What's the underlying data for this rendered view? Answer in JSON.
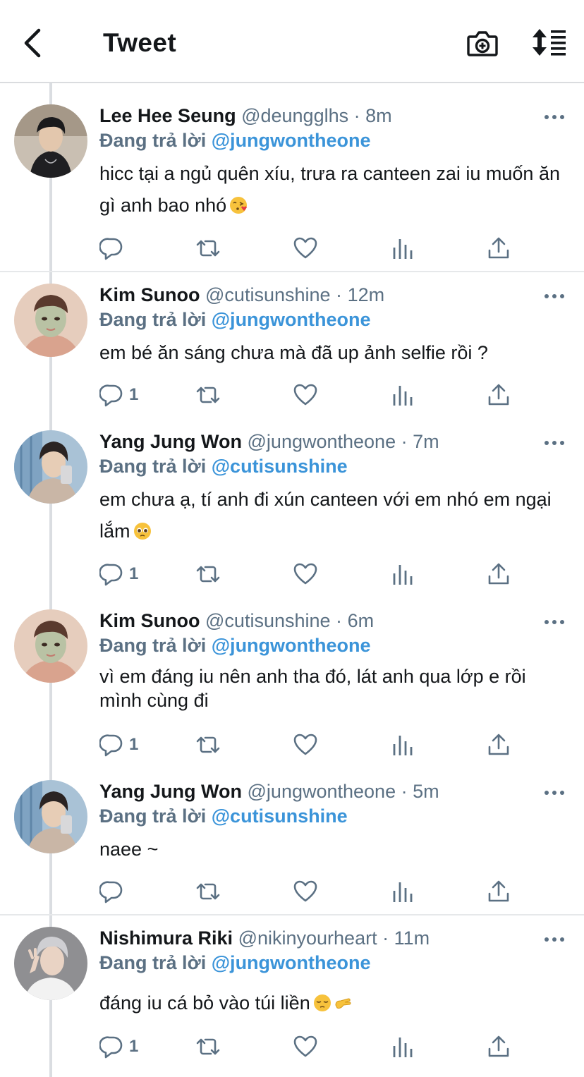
{
  "header": {
    "title": "Tweet",
    "back_icon": "chevron-left-icon",
    "camera_icon": "camera-add-icon",
    "sort_icon": "sort-icon"
  },
  "colors": {
    "mention": "#3b94d9",
    "muted": "#5b7083",
    "text": "#14171a",
    "separator": "#e6e8ea",
    "thread_line": "#dadde1"
  },
  "tweets": [
    {
      "name": "Lee Hee Seung",
      "handle": "@deungglhs",
      "dot": "·",
      "time": "8m",
      "reply_prefix": "Đang trả lời",
      "reply_to": "@jungwontheone",
      "text": "hicc tại a ngủ quên xíu, trưa ra canteen zai iu muốn ăn gì anh bao nhó",
      "emoji": [
        "face-blowing-kiss"
      ],
      "reply_count": ""
    },
    {
      "name": "Kim Sunoo",
      "handle": "@cutisunshine",
      "dot": "·",
      "time": "12m",
      "reply_prefix": "Đang trả lời",
      "reply_to": "@jungwontheone",
      "text": "em bé ăn sáng chưa mà đã up ảnh selfie rồi ?",
      "emoji": [],
      "reply_count": "1"
    },
    {
      "name": "Yang Jung Won",
      "handle": "@jungwontheone",
      "dot": "·",
      "time": "7m",
      "reply_prefix": "Đang trả lời",
      "reply_to": "@cutisunshine",
      "text": "em chưa ạ, tí anh đi xún canteen với em nhó em ngại lắm",
      "emoji": [
        "pleading-face"
      ],
      "reply_count": "1"
    },
    {
      "name": "Kim Sunoo",
      "handle": "@cutisunshine",
      "dot": "·",
      "time": "6m",
      "reply_prefix": "Đang trả lời",
      "reply_to": "@jungwontheone",
      "text": "vì em đáng iu nên anh tha đó, lát anh qua lớp e rồi mình cùng đi",
      "emoji": [],
      "reply_count": "1"
    },
    {
      "name": "Yang Jung Won",
      "handle": "@jungwontheone",
      "dot": "·",
      "time": "5m",
      "reply_prefix": "Đang trả lời",
      "reply_to": "@cutisunshine",
      "text": "naee ~",
      "emoji": [],
      "reply_count": ""
    },
    {
      "name": "Nishimura Riki",
      "handle": "@nikinyourheart",
      "dot": "·",
      "time": "11m",
      "reply_prefix": "Đang trả lời",
      "reply_to": "@jungwontheone",
      "text": "đáng iu cá bỏ vào túi liền",
      "emoji": [
        "pensive-face",
        "pinching-hand"
      ],
      "reply_count": "1"
    }
  ]
}
